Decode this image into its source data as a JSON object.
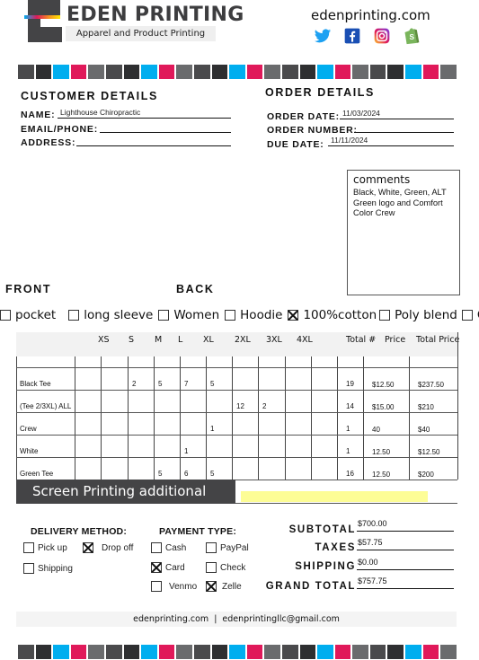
{
  "header": {
    "brand_name": "EDEN PRINTING",
    "brand_tagline": "Apparel and Product Printing",
    "website": "edenprinting.com",
    "social_icons": [
      "twitter-icon",
      "facebook-icon",
      "instagram-icon",
      "shopify-icon"
    ]
  },
  "strip_colors": [
    "#4a4a4c",
    "#2e2f31",
    "#00aeef",
    "#e0195a",
    "#6a6b6d",
    "#4a4a4c",
    "#2e2f31",
    "#00aeef",
    "#e0195a",
    "#6a6b6d",
    "#4a4a4c",
    "#2e2f31",
    "#00aeef",
    "#e0195a",
    "#6a6b6d",
    "#4a4a4c",
    "#2e2f31",
    "#00aeef",
    "#e0195a",
    "#6a6b6d",
    "#4a4a4c",
    "#2e2f31",
    "#00aeef",
    "#e0195a",
    "#6a6b6d"
  ],
  "customer": {
    "title": "CUSTOMER DETAILS",
    "name_label": "NAME:",
    "name_value": "Lighthouse Chiropractic",
    "email_label": "EMAIL/PHONE:",
    "email_value": "",
    "address_label": "ADDRESS:",
    "address_value": ""
  },
  "order": {
    "title": "ORDER DETAILS",
    "date_label": "ORDER DATE:",
    "date_value": "11/03/2024",
    "number_label": "ORDER NUMBER:",
    "number_value": "",
    "due_label": "DUE DATE:",
    "due_value": "11/11/2024"
  },
  "comments": {
    "title": "comments",
    "text": "Black, White, Green, ALT Green logo and Comfort Color Crew"
  },
  "placement": {
    "front": "FRONT",
    "back": "BACK"
  },
  "garment_options": [
    {
      "label": "pocket",
      "checked": false
    },
    {
      "label": "long sleeve",
      "checked": false
    },
    {
      "label": "Women",
      "checked": false
    },
    {
      "label": "Hoodie",
      "checked": false
    },
    {
      "label": "100%cotton",
      "checked": true
    },
    {
      "label": "Poly blend",
      "checked": false
    },
    {
      "label": "Other",
      "checked": false
    }
  ],
  "table": {
    "headers": [
      "",
      "XS",
      "S",
      "M",
      "L",
      "XL",
      "2XL",
      "3XL",
      "4XL",
      "",
      "Total #",
      "Price",
      "Total Price"
    ],
    "rows": [
      {
        "item": "Black Tee",
        "sizes": [
          "",
          "",
          "2",
          "5",
          "7",
          "5",
          "",
          "",
          "",
          ""
        ],
        "total": "19",
        "price": "$12.50",
        "total_price": "$237.50"
      },
      {
        "item": "(Tee 2/3XL) ALL",
        "sizes": [
          "",
          "",
          "",
          "",
          "",
          "",
          "12",
          "2",
          "",
          ""
        ],
        "total": "14",
        "price": "$15.00",
        "total_price": "$210"
      },
      {
        "item": "Crew",
        "sizes": [
          "",
          "",
          "",
          "",
          "",
          "1",
          "",
          "",
          "",
          ""
        ],
        "total": "1",
        "price": "40",
        "total_price": "$40"
      },
      {
        "item": "White",
        "sizes": [
          "",
          "",
          "",
          "",
          "1",
          "",
          "",
          "",
          "",
          ""
        ],
        "total": "1",
        "price": "12.50",
        "total_price": "$12.50"
      },
      {
        "item": "Green Tee",
        "sizes": [
          "",
          "",
          "",
          "5",
          "6",
          "5",
          "",
          "",
          "",
          ""
        ],
        "total": "16",
        "price": "12.50",
        "total_price": "$200"
      }
    ],
    "screen_printing_label": "Screen Printing additional cost",
    "screen_printing_value": ""
  },
  "delivery": {
    "title": "DELIVERY METHOD:",
    "options": [
      {
        "label": "Pick up",
        "checked": false
      },
      {
        "label": "Drop off",
        "checked": true
      },
      {
        "label": "Shipping",
        "checked": false
      }
    ]
  },
  "payment": {
    "title": "PAYMENT TYPE:",
    "options": [
      {
        "label": "Cash",
        "checked": false
      },
      {
        "label": "PayPal",
        "checked": false
      },
      {
        "label": "Card",
        "checked": true
      },
      {
        "label": "Check",
        "checked": false
      },
      {
        "label": "Venmo",
        "checked": false
      },
      {
        "label": "Zelle",
        "checked": true
      }
    ]
  },
  "totals": {
    "subtotal_label": "SUBTOTAL",
    "subtotal_value": "$700.00",
    "taxes_label": "TAXES",
    "taxes_value": "$57.75",
    "shipping_label": "SHIPPING",
    "shipping_value": "$0.00",
    "grand_label": "GRAND TOTAL",
    "grand_value": "$757.75"
  },
  "footer": {
    "text": "edenprinting.com  |  edenprintingllc@gmail.com"
  }
}
